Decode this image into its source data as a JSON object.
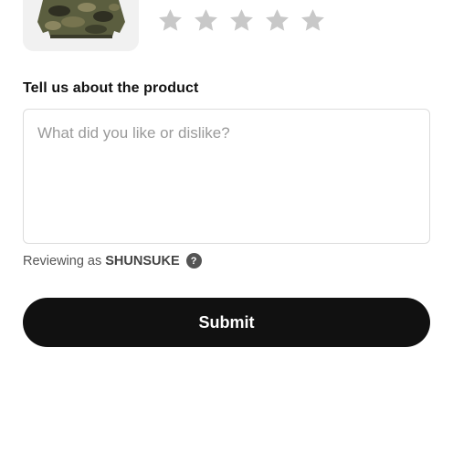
{
  "product": {
    "image_icon": "camo-sweater-thumbnail"
  },
  "rating": {
    "value": 0,
    "max": 5,
    "star_color": "#c8c8c8",
    "icon": "star-icon"
  },
  "review": {
    "label": "Tell us about the product",
    "placeholder": "What did you like or dislike?",
    "value": ""
  },
  "reviewer": {
    "prefix": "Reviewing as",
    "name": "SHUNSUKE",
    "help_icon_glyph": "?"
  },
  "submit": {
    "label": "Submit",
    "background": "#111111",
    "text_color": "#ffffff"
  }
}
